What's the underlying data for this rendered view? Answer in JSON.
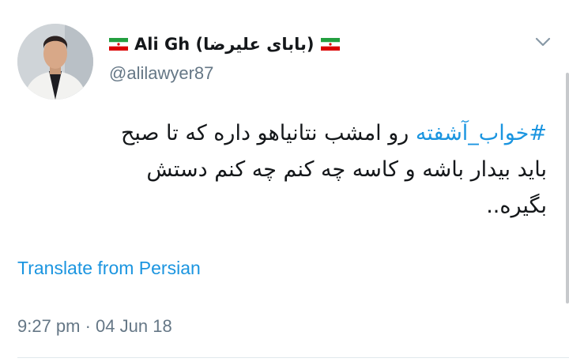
{
  "author": {
    "display_name": "Ali Gh (بابای علیرضا)",
    "handle": "@alilawyer87",
    "flag_icon": "iran-flag-icon"
  },
  "tweet": {
    "hashtag": "#خواب_آشفته",
    "text": " رو امشب نتانیاهو داره که تا صبح باید بیدار باشه و کاسه چه کنم چه کنم دستش بگیره..",
    "translate_label": "Translate from Persian",
    "timestamp": "9:27 pm · 04 Jun 18"
  },
  "colors": {
    "link": "#1b95e0",
    "secondary_text": "#657786",
    "primary_text": "#14171a"
  }
}
